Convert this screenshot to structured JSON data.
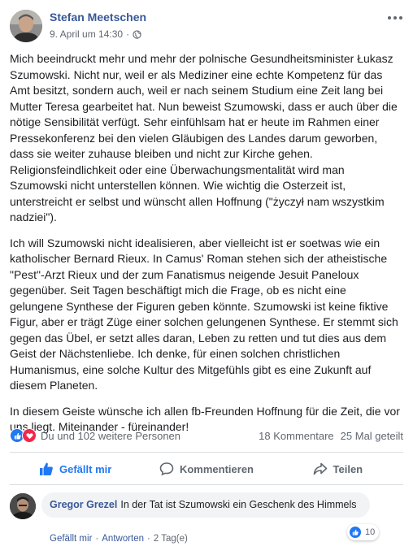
{
  "post": {
    "author": "Stefan Meetschen",
    "date": "9. April um 14:30",
    "separator": "·",
    "paragraphs": [
      "Mich beeindruckt mehr und mehr der polnische Gesundheitsminister Łukasz Szumowski. Nicht nur, weil er als Mediziner eine echte Kompetenz für das Amt besitzt, sondern auch, weil er nach seinem Studium eine Zeit lang bei Mutter Teresa gearbeitet hat. Nun beweist Szumowski, dass er auch über die nötige Sensibilität verfügt. Sehr einfühlsam hat er heute im Rahmen einer Pressekonferenz bei den vielen Gläubigen des Landes darum geworben, dass sie weiter zuhause bleiben und nicht zur Kirche gehen. Religionsfeindlichkeit oder eine Überwachungsmentalität wird man Szumowski nicht unterstellen können. Wie wichtig die Osterzeit ist, unterstreicht er selbst und wünscht allen Hoffnung (\"życzył nam wszystkim nadziei\").",
      "Ich will Szumowski nicht idealisieren, aber vielleicht ist er soetwas wie ein katholischer Bernard Rieux. In Camus' Roman stehen sich der atheistische \"Pest\"-Arzt Rieux und der zum Fanatismus neigende Jesuit Paneloux gegenüber. Seit Tagen beschäftigt mich die Frage, ob es nicht eine gelungene Synthese der Figuren geben könnte. Szumowski ist keine fiktive Figur, aber er trägt Züge einer solchen gelungenen Synthese. Er stemmt sich gegen das Übel, er setzt alles daran, Leben zu retten und tut dies aus dem Geist der Nächstenliebe. Ich denke, für einen solchen christlichen Humanismus, eine solche Kultur des Mitgefühls gibt es eine Zukunft auf diesem Planeten.",
      "In diesem Geiste wünsche ich allen fb-Freunden Hoffnung für die Zeit, die vor uns liegt. Miteinander - füreinander!"
    ],
    "reactions_text": "Du und 102 weitere Personen",
    "comments_count": "18 Kommentare",
    "shares_count": "25 Mal geteilt"
  },
  "actions": {
    "like": "Gefällt mir",
    "comment": "Kommentieren",
    "share": "Teilen"
  },
  "comment": {
    "author": "Gregor Grezel",
    "text": "In der Tat ist Szumowski ein Geschenk des Himmels",
    "like_link": "Gefällt mir",
    "reply_link": "Antworten",
    "dot": "·",
    "age": "2 Tag(e)",
    "reaction_count": "10"
  },
  "colors": {
    "link": "#385898",
    "like": "#2078f4",
    "love": "#f0284a"
  },
  "icons": {
    "privacy": "globe-icon",
    "more": "more-options-icon",
    "like": "thumbs-up-icon",
    "comment": "speech-bubble-icon",
    "share": "share-arrow-icon"
  }
}
